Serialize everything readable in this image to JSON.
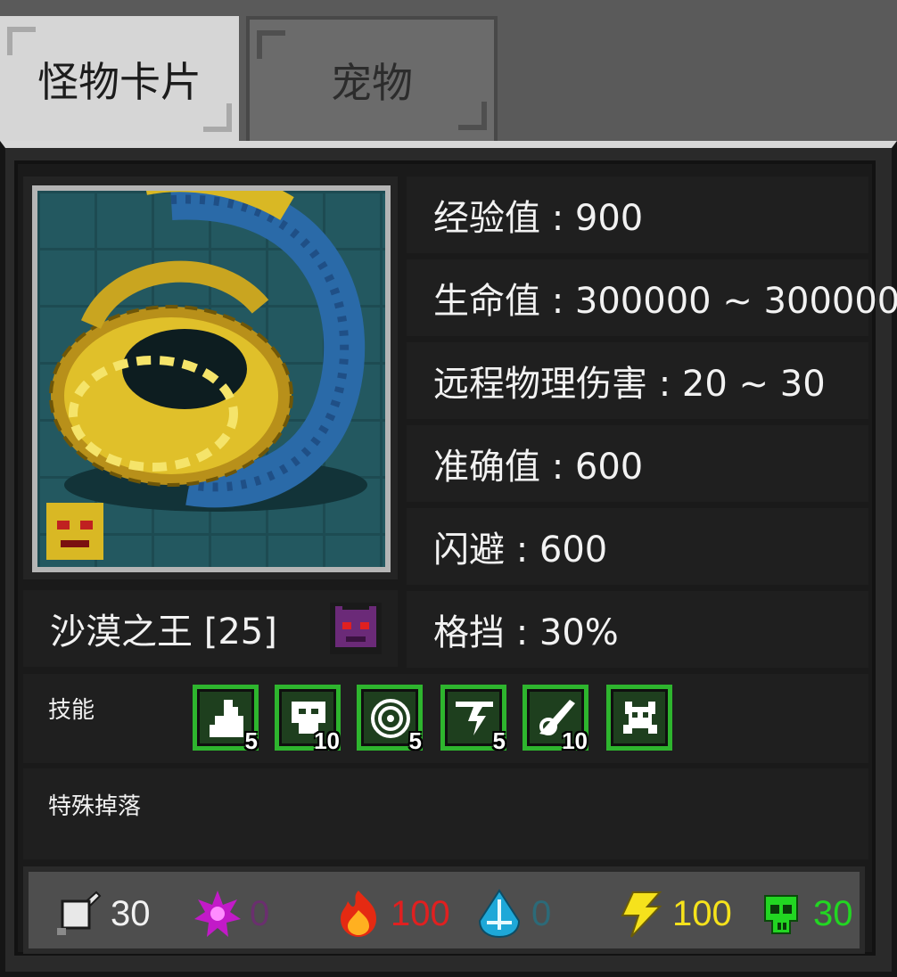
{
  "tabs": {
    "monster_card": "怪物卡片",
    "pet": "宠物"
  },
  "monster": {
    "name": "沙漠之王 [25]",
    "element_icon": "purple-demon-icon",
    "portrait": "golden-sandworm"
  },
  "stats": {
    "exp": "经验值 : 900",
    "hp": "生命值 : 300000 ~ 300000",
    "ranged_damage": "远程物理伤害 : 20 ~ 30",
    "accuracy": "准确值 : 600",
    "evasion": "闪避 : 600",
    "block": "格挡 : 30%"
  },
  "skills": {
    "label": "技能",
    "items": [
      {
        "icon": "hooded-figure-icon",
        "level": "5"
      },
      {
        "icon": "beast-face-icon",
        "level": "10"
      },
      {
        "icon": "vortex-icon",
        "level": "5"
      },
      {
        "icon": "shatter-icon",
        "level": "5"
      },
      {
        "icon": "slash-icon",
        "level": "10"
      },
      {
        "icon": "goblin-icon",
        "level": ""
      }
    ]
  },
  "special_drop": {
    "label": "特殊掉落"
  },
  "resistances": [
    {
      "icon": "physical-sword-icon",
      "value": "30",
      "color": "#f2f2f2"
    },
    {
      "icon": "arcane-star-icon",
      "value": "0",
      "color": "#6a2f6e"
    },
    {
      "icon": "fire-icon",
      "value": "100",
      "color": "#e02020"
    },
    {
      "icon": "water-drop-icon",
      "value": "0",
      "color": "#2c6a78"
    },
    {
      "icon": "lightning-icon",
      "value": "100",
      "color": "#f5e21c"
    },
    {
      "icon": "poison-skull-icon",
      "value": "30",
      "color": "#22d622"
    }
  ]
}
